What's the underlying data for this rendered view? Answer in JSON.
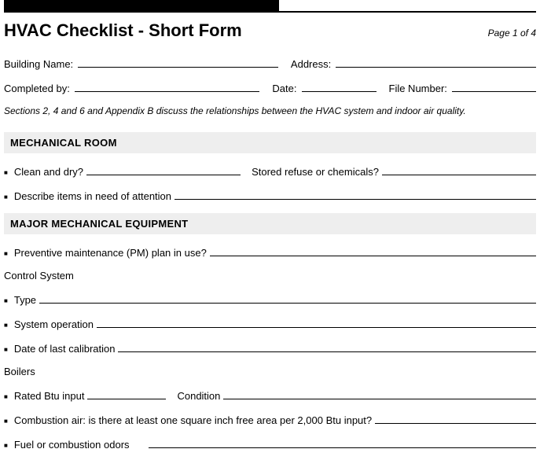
{
  "header": {
    "title": "HVAC Checklist - Short Form",
    "page_indicator": "Page 1 of 4"
  },
  "top_fields": {
    "building_name": "Building Name:",
    "address": "Address:",
    "completed_by": "Completed by:",
    "date": "Date:",
    "file_number": "File Number:"
  },
  "note": "Sections 2, 4 and 6 and Appendix B discuss the relationships between the HVAC system and indoor air quality.",
  "sections": {
    "mechanical_room": {
      "heading": "MECHANICAL ROOM",
      "items": {
        "clean_dry": "Clean and dry?",
        "stored_refuse": "Stored refuse or chemicals?",
        "describe_attention": "Describe items in need of attention"
      }
    },
    "major_equipment": {
      "heading": "MAJOR MECHANICAL EQUIPMENT",
      "pm_plan": "Preventive maintenance (PM) plan in use?",
      "control_system": {
        "heading": "Control System",
        "type": "Type",
        "system_operation": "System operation",
        "last_calibration": "Date of last calibration"
      },
      "boilers": {
        "heading": "Boilers",
        "rated_btu": "Rated Btu input",
        "condition": "Condition",
        "combustion_air": "Combustion air: is there at least one square inch free area per 2,000 Btu input?",
        "fuel_odors": "Fuel or combustion odors"
      }
    }
  }
}
